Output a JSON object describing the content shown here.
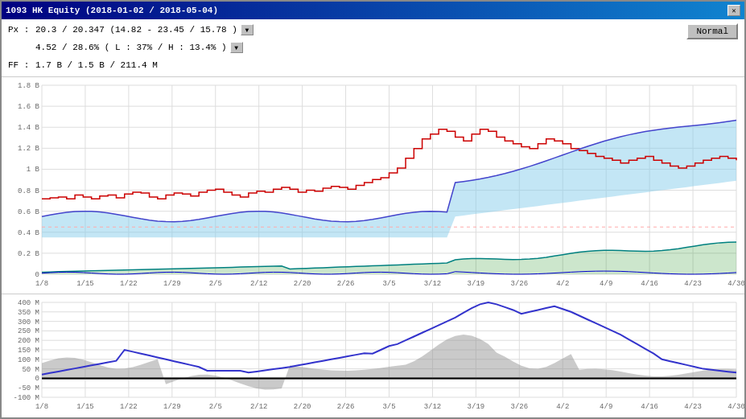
{
  "window": {
    "title": "1093 HK Equity (2018-01-02 / 2018-05-04)",
    "close_label": "✕"
  },
  "info": {
    "px_label": "Px :",
    "px_value": "20.3 / 20.347  (14.82 - 23.45 / 15.78 )",
    "pct_value": "4.52 / 28.6%  ( L : 37% / H : 13.4% )",
    "ff_label": "FF :",
    "ff_value": "1.7 B / 1.5 B / 211.4 M"
  },
  "normal_button": "Normal",
  "upper_chart": {
    "y_labels": [
      "1.8 B",
      "1.6 B",
      "1.4 B",
      "1.2 B",
      "1 B",
      "0.8 B",
      "0.6 B",
      "0.4 B",
      "0.2 B",
      "0"
    ],
    "x_labels": [
      "1/8",
      "1/15",
      "1/22",
      "1/29",
      "2/5",
      "2/12",
      "2/20",
      "2/26",
      "3/5",
      "3/12",
      "3/19",
      "3/26",
      "4/2",
      "4/9",
      "4/16",
      "4/23",
      "4/30"
    ]
  },
  "lower_chart": {
    "y_labels": [
      "400 M",
      "350 M",
      "300 M",
      "250 M",
      "200 M",
      "150 M",
      "100 M",
      "50 M",
      "0",
      "-50 M",
      "-100 M"
    ],
    "x_labels": [
      "1/8",
      "1/15",
      "1/22",
      "1/29",
      "2/5",
      "2/12",
      "2/20",
      "2/26",
      "3/5",
      "3/12",
      "3/19",
      "3/26",
      "4/2",
      "4/9",
      "4/16",
      "4/23",
      "4/30"
    ]
  },
  "colors": {
    "accent_blue": "#000080",
    "chart_red": "#cc0000",
    "chart_blue": "#0000cc",
    "chart_teal": "#008080",
    "chart_light_blue": "#add8e6",
    "chart_pink": "#ffaaaa",
    "chart_gray": "#aaaaaa",
    "grid_color": "#dddddd"
  }
}
